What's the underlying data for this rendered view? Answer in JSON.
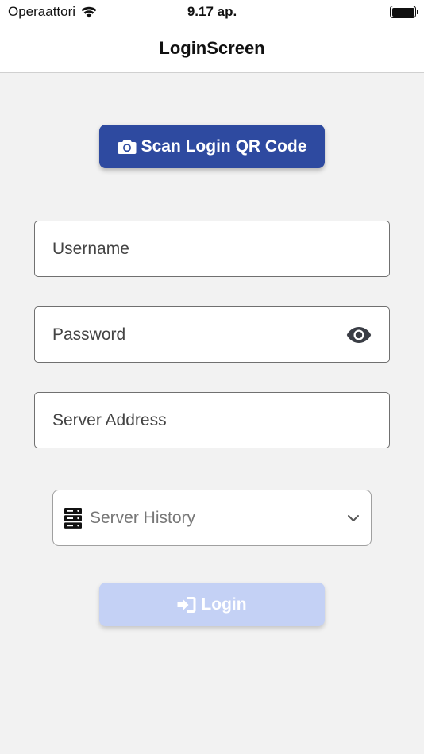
{
  "status_bar": {
    "carrier": "Operaattori",
    "time": "9.17 ap.",
    "wifi_icon": "wifi-icon",
    "battery_icon": "battery-icon"
  },
  "header": {
    "title": "LoginScreen"
  },
  "qr_button": {
    "label": "Scan Login QR Code",
    "icon": "camera-icon",
    "color": "#2e4aa0"
  },
  "form": {
    "username": {
      "placeholder": "Username",
      "value": ""
    },
    "password": {
      "placeholder": "Password",
      "value": "",
      "toggle_icon": "eye-icon"
    },
    "server_address": {
      "placeholder": "Server Address",
      "value": ""
    }
  },
  "server_history": {
    "label": "Server History",
    "icon": "server-icon",
    "dropdown_icon": "chevron-down-icon"
  },
  "login_button": {
    "label": "Login",
    "icon": "sign-in-icon",
    "color": "#c4d1f5",
    "disabled": true
  }
}
